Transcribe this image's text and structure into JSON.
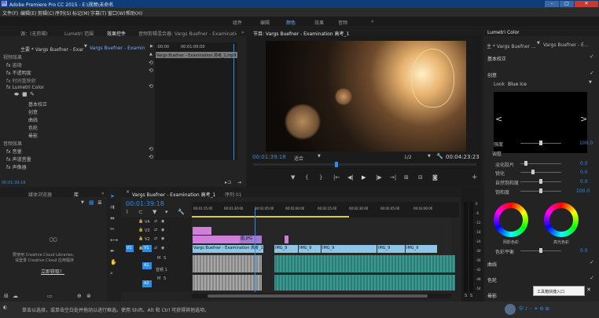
{
  "window": {
    "title": "Adobe Premiere Pro CC 2015 - E:\\视频\\未命名"
  },
  "menu": [
    "文件(F)",
    "编辑(E)",
    "剪辑(C)",
    "序列(S)",
    "标记(M)",
    "字幕(T)",
    "窗口(W)",
    "帮助(H)"
  ],
  "workspaces": [
    "组件",
    "编辑",
    "颜色",
    "效果",
    "音频",
    "»"
  ],
  "left_panel": {
    "tabs": [
      "源：(无剪辑)",
      "Lumetri 范围",
      "效果控件",
      "音频剪辑混合器: Vargs Buefner - Examination 9",
      "»"
    ],
    "header_left": "主要 * Vargs Buefner - Exam...",
    "header_right": "Vargs Buefner - Examinatio...",
    "ruler": [
      ":00:00",
      "00:01:00:00"
    ],
    "clip_label": "Vargs Buefner - Examination 高考_1.mp4",
    "rows": [
      "视频效果",
      "fx 运动",
      "fx 不透明度",
      "fx 时间重映射",
      "fx Lumetri Color",
      "基本校正",
      "创意",
      "曲线",
      "色轮",
      "晕影",
      "音频效果",
      "fx 音量",
      "fx 声道音量",
      "fx 声像器"
    ],
    "timecode": "00:01:39:18"
  },
  "program": {
    "title": "节目: Vargs Buefner - Examination 高考_1",
    "timecode": "00:01:39:18",
    "fit": "适合",
    "quality": "1/2",
    "duration": "00:04:23:23",
    "controls": [
      "▼",
      "{",
      "}",
      "|←",
      "◀|",
      "▶",
      "|▶",
      "→|",
      "⊞",
      "⊟",
      "◙"
    ]
  },
  "lumetri": {
    "title": "Lumetri Color",
    "header_left": "主 * Vargs Buefner ...",
    "header_right": "Vargs Buefner - E...",
    "sections": [
      "基本校正",
      "创意",
      "曲线",
      "色轮",
      "晕影"
    ],
    "look_label": "Look",
    "look_value": "Blue Ice",
    "intensity_label": "强度",
    "intensity_value": "100.0",
    "adjust_label": "调整",
    "adjust_rows": [
      {
        "label": "淡化胶片",
        "value": "0.0"
      },
      {
        "label": "锐化",
        "value": "0.0"
      },
      {
        "label": "自然饱和度",
        "value": "0.0"
      },
      {
        "label": "饱和度",
        "value": "100.0"
      }
    ],
    "shadow_label": "阴影色彩",
    "highlight_label": "高光色彩",
    "balance_label": "色彩平衡",
    "balance_value": "0.0"
  },
  "project": {
    "tabs": [
      "媒体浏览器",
      "库",
      "»"
    ],
    "lib_text1": "要使用 Creative Cloud Libraries,",
    "lib_text2": "请登录 Creative Cloud 应用程序",
    "lib_link": "立即获取！"
  },
  "timeline": {
    "tab": "Vargs Buefner - Examination 高考_1",
    "tab2": "序列 01",
    "timecode": "00:01:39:18",
    "ruler": [
      "00:01:15:00",
      "00:01:30:00",
      "00:01:45:00",
      "00:02:00:00",
      "00:02:15:00",
      "00:02:30:00",
      "00:02:45:00",
      "00:03:00:00"
    ],
    "tracks": [
      "V4",
      "V3",
      "V2",
      "V1",
      "A1",
      "A2",
      "A3"
    ],
    "clip_v1": "Vargs Buefner - Examination 高考_1.mp4 [V]",
    "clip_v2": "图.JPG",
    "img_labels": [
      "IMG_9",
      "IMG_9",
      "IMG_9",
      "IMG_9",
      "IMG_9"
    ],
    "audio_label": "音频 1"
  },
  "meter_labels": [
    "0",
    "-6",
    "-12",
    "-18",
    "-24",
    "-30",
    "-36",
    "-42",
    "-48",
    "-54"
  ],
  "status": "单击以选择，或单击空白处并拖动以进行框选。使用 Shift、Alt 和 Ctrl 可获得其他选项。",
  "toast": "工具箱快捷入口",
  "colors": {
    "accent": "#2d8ceb",
    "video_clip": "#8fc6e6",
    "audio_clip": "#3fa79e",
    "pink": "#d07fd8",
    "image_clip": "#6fbf63"
  }
}
